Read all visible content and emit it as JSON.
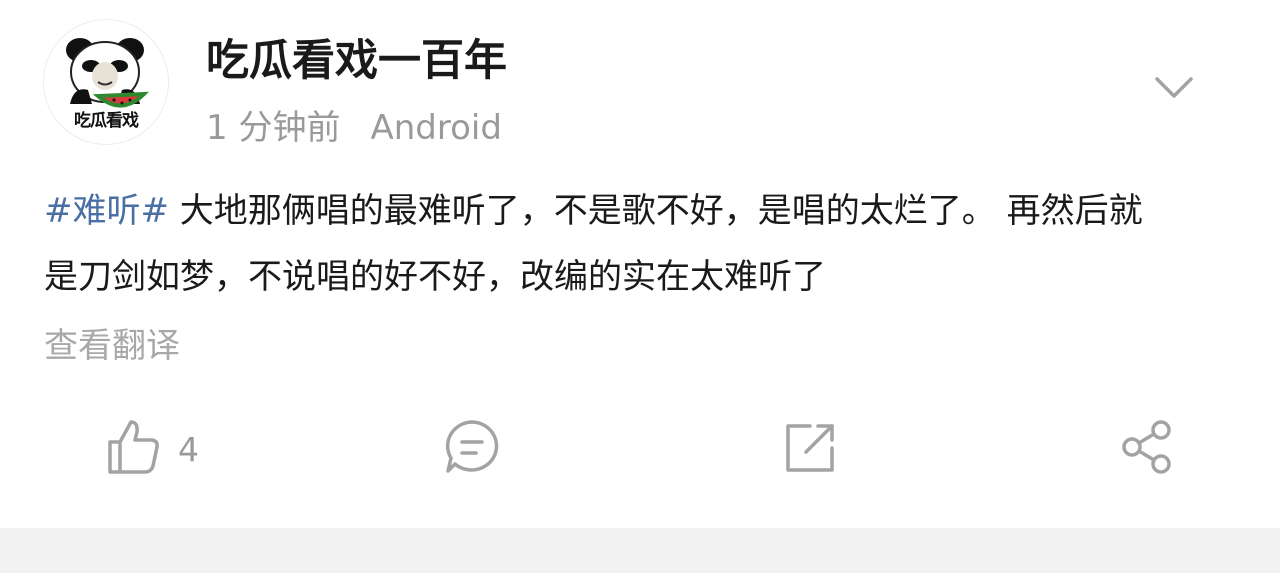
{
  "post": {
    "avatar_caption": "吃瓜看戏",
    "username": "吃瓜看戏一百年",
    "time": "1 分钟前",
    "source": "Android",
    "hashtag": "#难听#",
    "text_line1": " 大地那俩唱的最难听了，不是歌不好，是唱的太烂了。 再然后就",
    "text_line2": "是刀剑如梦，不说唱的好不好，改编的实在太难听了",
    "translate_label": "查看翻译"
  },
  "actions": {
    "like_count": "4",
    "icons": [
      "thumbs-up-icon",
      "comment-icon",
      "repost-icon",
      "share-icon",
      "chevron-down-icon"
    ]
  },
  "colors": {
    "hashtag": "#4a6fa5",
    "meta": "#9a9a9a",
    "icon": "#a3a3a3",
    "bottom_band": "#f2f2f2"
  }
}
